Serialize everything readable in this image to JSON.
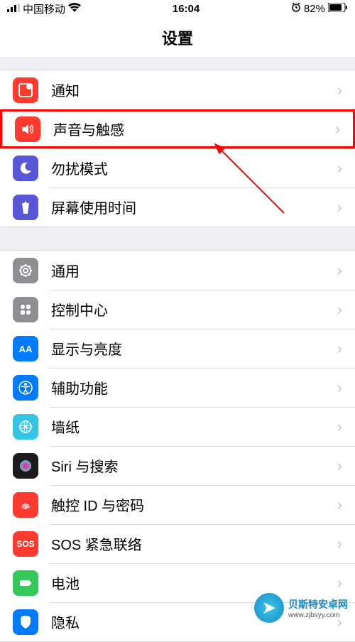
{
  "status": {
    "carrier": "中国移动",
    "time": "16:04",
    "battery": "82%"
  },
  "header": {
    "title": "设置"
  },
  "groups": [
    {
      "rows": [
        {
          "label": "通知",
          "iconColor": "#ff3b30",
          "iconName": "notification-icon",
          "highlighted": false
        },
        {
          "label": "声音与触感",
          "iconColor": "#ff3b30",
          "iconName": "sound-icon",
          "highlighted": true
        },
        {
          "label": "勿扰模式",
          "iconColor": "#5855d6",
          "iconName": "dnd-icon",
          "highlighted": false
        },
        {
          "label": "屏幕使用时间",
          "iconColor": "#5855d6",
          "iconName": "screentime-icon",
          "highlighted": false
        }
      ]
    },
    {
      "rows": [
        {
          "label": "通用",
          "iconColor": "#8e8e93",
          "iconName": "general-icon",
          "highlighted": false
        },
        {
          "label": "控制中心",
          "iconColor": "#8e8e93",
          "iconName": "control-center-icon",
          "highlighted": false
        },
        {
          "label": "显示与亮度",
          "iconColor": "#007aff",
          "iconName": "display-icon",
          "highlighted": false
        },
        {
          "label": "辅助功能",
          "iconColor": "#007aff",
          "iconName": "accessibility-icon",
          "highlighted": false
        },
        {
          "label": "墙纸",
          "iconColor": "#35c5e5",
          "iconName": "wallpaper-icon",
          "highlighted": false
        },
        {
          "label": "Siri 与搜索",
          "iconColor": "#1c1c1e",
          "iconName": "siri-icon",
          "highlighted": false
        },
        {
          "label": "触控 ID 与密码",
          "iconColor": "#ff3b30",
          "iconName": "touchid-icon",
          "highlighted": false
        },
        {
          "label": "SOS 紧急联络",
          "iconColor": "#ff3b30",
          "iconName": "sos-icon",
          "highlighted": false,
          "textIcon": "SOS"
        },
        {
          "label": "电池",
          "iconColor": "#34c759",
          "iconName": "battery-icon",
          "highlighted": false
        },
        {
          "label": "隐私",
          "iconColor": "#007aff",
          "iconName": "privacy-icon",
          "highlighted": false
        }
      ]
    }
  ],
  "watermark": {
    "brand": "贝斯特安卓网",
    "url": "www.zjbsyy.com"
  }
}
